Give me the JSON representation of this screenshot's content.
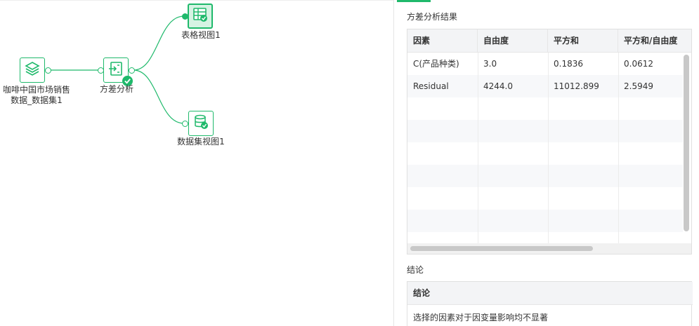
{
  "flow": {
    "nodes": [
      {
        "id": "dataset",
        "label_lines": [
          "咖啡中国市场销售",
          "数据_数据集1"
        ],
        "icon": "layers-icon"
      },
      {
        "id": "anova",
        "label_lines": [
          "方差分析"
        ],
        "icon": "analysis-icon",
        "status": "success"
      },
      {
        "id": "table_view",
        "label_lines": [
          "表格视图1"
        ],
        "icon": "table-view-icon"
      },
      {
        "id": "dataset_view",
        "label_lines": [
          "数据集视图1"
        ],
        "icon": "database-view-icon"
      }
    ]
  },
  "panel": {
    "result_title": "方差分析结果",
    "table": {
      "columns": [
        "因素",
        "自由度",
        "平方和",
        "平方和/自由度"
      ],
      "rows": [
        [
          "C(产品种类)",
          "3.0",
          "0.1836",
          "0.0612"
        ],
        [
          "Residual",
          "4244.0",
          "11012.899",
          "2.5949"
        ]
      ]
    },
    "conclusion_title": "结论",
    "conclusion_header": "结论",
    "conclusion_text": "选择的因素对于因变量影响均不显著"
  },
  "colors": {
    "accent": "#1fb96b",
    "header_bg": "#f3f4f6",
    "row_alt": "#f7f8fa"
  }
}
